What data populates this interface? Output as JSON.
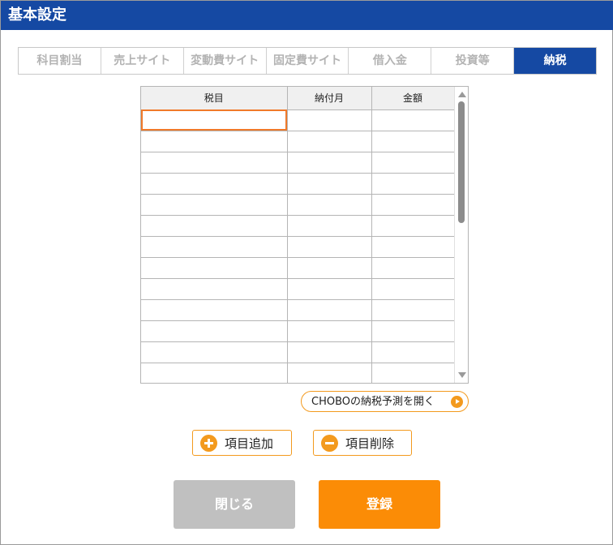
{
  "window": {
    "title": "基本設定"
  },
  "tabs": [
    {
      "label": "科目割当",
      "active": false
    },
    {
      "label": "売上サイト",
      "active": false
    },
    {
      "label": "変動費サイト",
      "active": false
    },
    {
      "label": "固定費サイト",
      "active": false
    },
    {
      "label": "借入金",
      "active": false
    },
    {
      "label": "投資等",
      "active": false
    },
    {
      "label": "納税",
      "active": true
    }
  ],
  "grid": {
    "columns": [
      "税目",
      "納付月",
      "金額"
    ],
    "rows": [
      [
        "",
        "",
        ""
      ],
      [
        "",
        "",
        ""
      ],
      [
        "",
        "",
        ""
      ],
      [
        "",
        "",
        ""
      ],
      [
        "",
        "",
        ""
      ],
      [
        "",
        "",
        ""
      ],
      [
        "",
        "",
        ""
      ],
      [
        "",
        "",
        ""
      ],
      [
        "",
        "",
        ""
      ],
      [
        "",
        "",
        ""
      ],
      [
        "",
        "",
        ""
      ],
      [
        "",
        "",
        ""
      ],
      [
        "",
        "",
        ""
      ]
    ]
  },
  "links": {
    "chobo_forecast": "CHOBOの納税予測を開く"
  },
  "actions": {
    "add_item": "項目追加",
    "delete_item": "項目削除"
  },
  "footer": {
    "close": "閉じる",
    "register": "登録"
  },
  "colors": {
    "brand": "#1549a3",
    "accent": "#fb8c06",
    "focus": "#f07a2a",
    "disabled": "#c0c0c0"
  },
  "icons": {
    "add": "plus-circle-icon",
    "delete": "minus-circle-icon",
    "open": "play-circle-icon"
  }
}
